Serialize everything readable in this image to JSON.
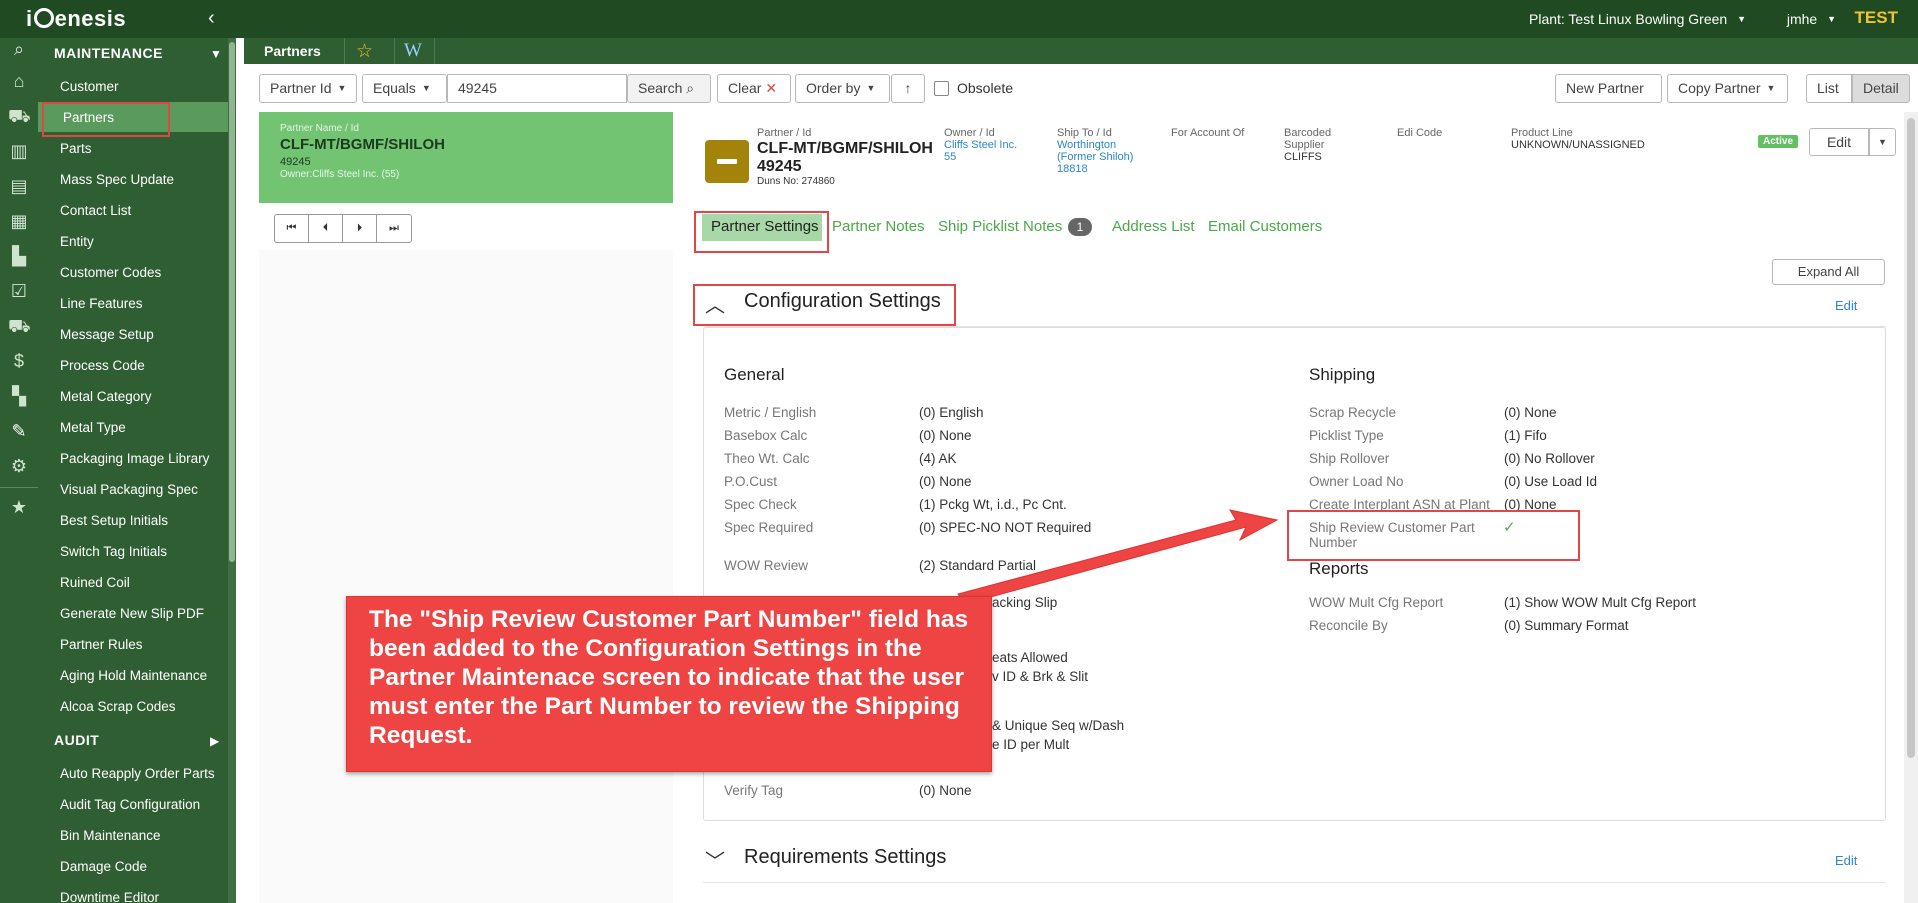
{
  "app": {
    "logo": "iGenesis",
    "plant_label": "Plant: Test Linux Bowling Green",
    "user": "jmhe",
    "env": "TEST"
  },
  "sidebar": {
    "section_maintenance": "MAINTENANCE",
    "section_audit": "AUDIT",
    "maintenance_items": [
      "Customer",
      "Partners",
      "Parts",
      "Mass Spec Update",
      "Contact List",
      "Entity",
      "Customer Codes",
      "Line Features",
      "Message Setup",
      "Process Code",
      "Metal Category",
      "Metal Type",
      "Packaging Image Library",
      "Visual Packaging Spec",
      "Best Setup Initials",
      "Switch Tag Initials",
      "Ruined Coil",
      "Generate New Slip PDF",
      "Partner Rules",
      "Aging Hold Maintenance",
      "Alcoa Scrap Codes"
    ],
    "audit_items": [
      "Auto Reapply Order Parts",
      "Audit Tag Configuration",
      "Bin Maintenance",
      "Damage Code",
      "Downtime Editor"
    ],
    "icons": [
      "search-icon",
      "home-icon",
      "truck-icon",
      "warehouse-icon",
      "document-icon",
      "calendar-icon",
      "factory-icon",
      "clipboard-icon",
      "delivery-icon",
      "invoice-icon",
      "report-icon",
      "wrench-icon",
      "gears-icon",
      "star-icon"
    ]
  },
  "subheader": {
    "title": "Partners",
    "wiki": "W"
  },
  "toolbar": {
    "field": "Partner Id",
    "operator": "Equals",
    "search_value": "49245",
    "search_label": "Search",
    "clear_label": "Clear",
    "order_by_label": "Order by",
    "obsolete_label": "Obsolete",
    "new_partner_label": "New Partner",
    "copy_partner_label": "Copy Partner",
    "list_label": "List",
    "detail_label": "Detail"
  },
  "list_card": {
    "label": "Partner Name / Id",
    "name": "CLF-MT/BGMF/SHILOH",
    "id": "49245",
    "owner": "Owner:Cliffs Steel Inc. (55)",
    "ship_to": "Ship To: Worthington (Former Shiloh) (18818)"
  },
  "detail_header": {
    "partner_label": "Partner / Id",
    "partner_name": "CLF-MT/BGMF/SHILOH",
    "partner_id": "49245",
    "duns": "Duns No: 274860",
    "owner_label": "Owner / Id",
    "owner_name": "Cliffs Steel Inc.",
    "owner_id": "55",
    "shipto_label": "Ship To / Id",
    "shipto_name_1": "Worthington",
    "shipto_name_2": "(Former Shiloh)",
    "shipto_id": "18818",
    "for_account_label": "For Account Of",
    "barcoded_label_1": "Barcoded",
    "barcoded_label_2": "Supplier",
    "barcoded_value": "CLIFFS",
    "edi_label": "Edi Code",
    "product_line_label": "Product Line",
    "product_line_value": "UNKNOWN/UNASSIGNED",
    "status": "Active",
    "edit_label": "Edit"
  },
  "tabs": {
    "settings": "Partner Settings",
    "notes": "Partner Notes",
    "ship_picklist": "Ship Picklist Notes",
    "ship_picklist_count": "1",
    "address": "Address List",
    "email": "Email Customers"
  },
  "config": {
    "expand_all": "Expand All",
    "title": "Configuration Settings",
    "edit": "Edit",
    "general_title": "General",
    "shipping_title": "Shipping",
    "reports_title": "Reports",
    "general": [
      {
        "label": "Metric / English",
        "value": "(0) English"
      },
      {
        "label": "Basebox Calc",
        "value": "(0) None"
      },
      {
        "label": "Theo Wt. Calc",
        "value": "(4) AK"
      },
      {
        "label": "P.O.Cust",
        "value": "(0) None"
      },
      {
        "label": "Spec Check",
        "value": "(1) Pckg Wt, i.d., Pc Cnt."
      },
      {
        "label": "Spec Required",
        "value": "(0) SPEC-NO NOT Required"
      },
      {
        "label": "WOW Review",
        "value": "(2) Standard Partial"
      }
    ],
    "general_partial": [
      "acking Slip",
      "eats Allowed",
      "v ID & Brk & Slit",
      "& Unique Seq w/Dash",
      "e ID per Mult"
    ],
    "verify_tag": {
      "label": "Verify Tag",
      "value": "(0) None"
    },
    "shipping": [
      {
        "label": "Scrap Recycle",
        "value": "(0) None"
      },
      {
        "label": "Picklist Type",
        "value": "(1) Fifo"
      },
      {
        "label": "Ship Rollover",
        "value": "(0) No Rollover"
      },
      {
        "label": "Owner Load No",
        "value": "(0) Use Load Id"
      },
      {
        "label": "Create Interplant ASN at Plant",
        "value": "(0) None"
      }
    ],
    "ship_review_label_1": "Ship Review Customer Part",
    "ship_review_label_2": "Number",
    "ship_review_check": "✓",
    "reports": [
      {
        "label": "WOW Mult Cfg Report",
        "value": "(1) Show WOW Mult Cfg Report"
      },
      {
        "label": "Reconcile By",
        "value": "(0) Summary Format"
      }
    ]
  },
  "requirements": {
    "title": "Requirements Settings",
    "edit": "Edit"
  },
  "callout": {
    "text": "The \"Ship Review Customer Part Number\" field has been added to the Configuration Settings in the Partner Maintenace screen to indicate that the user must enter the Part Number to review the Shipping Request."
  },
  "colors": {
    "brand_dark": "#1f4a22",
    "brand": "#2e5e32",
    "accent_green": "#72c472",
    "highlight_red": "#e14545",
    "link": "#2c86c9"
  }
}
